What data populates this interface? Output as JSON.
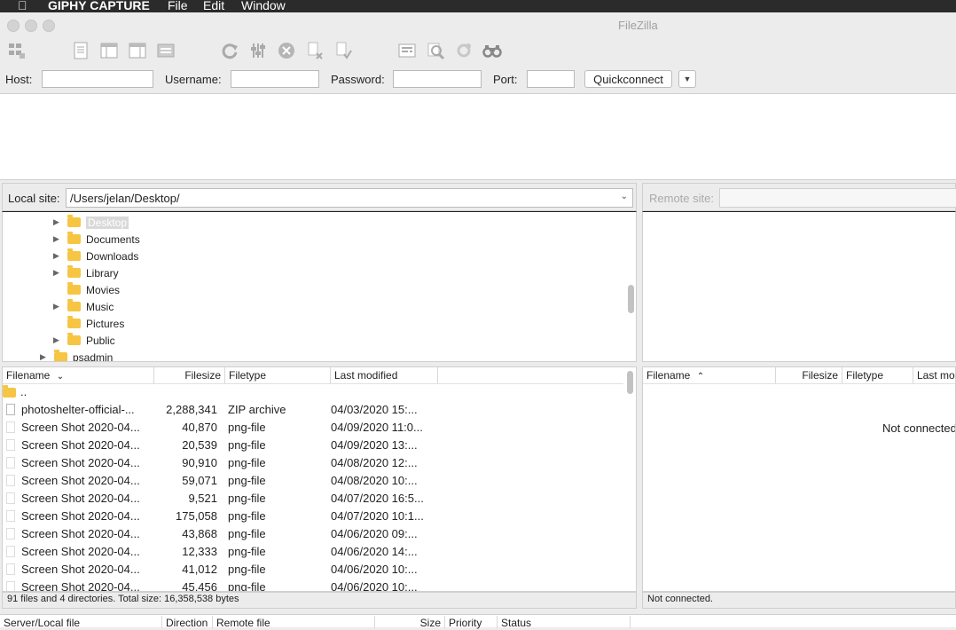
{
  "menubar": {
    "app_name": "GIPHY CAPTURE",
    "items": [
      "File",
      "Edit",
      "Window"
    ]
  },
  "window": {
    "title": "FileZilla"
  },
  "toolbar": {
    "icons": [
      "site-manager-icon",
      "toggle-log-icon",
      "toggle-local-tree-icon",
      "toggle-remote-tree-icon",
      "transfer-queue-icon",
      "refresh-icon",
      "process-queue-icon",
      "cancel-icon",
      "disconnect-icon",
      "reconnect-icon",
      "directory-listing-filter-icon",
      "toggle-compare-icon",
      "sync-browsing-icon",
      "search-icon"
    ]
  },
  "quickconnect": {
    "host_label": "Host:",
    "username_label": "Username:",
    "password_label": "Password:",
    "port_label": "Port:",
    "host_value": "",
    "username_value": "",
    "password_value": "",
    "port_value": "",
    "button_label": "Quickconnect"
  },
  "local_site": {
    "label": "Local site:",
    "path": "/Users/jelan/Desktop/",
    "tree": [
      {
        "name": "Desktop",
        "expandable": true,
        "selected": true
      },
      {
        "name": "Documents",
        "expandable": true
      },
      {
        "name": "Downloads",
        "expandable": true
      },
      {
        "name": "Library",
        "expandable": true
      },
      {
        "name": "Movies",
        "expandable": false
      },
      {
        "name": "Music",
        "expandable": true
      },
      {
        "name": "Pictures",
        "expandable": false
      },
      {
        "name": "Public",
        "expandable": true
      },
      {
        "name": "psadmin",
        "expandable": true
      }
    ]
  },
  "remote_site": {
    "label": "Remote site:",
    "path": ""
  },
  "local_list": {
    "headers": [
      "Filename",
      "Filesize",
      "Filetype",
      "Last modified"
    ],
    "rows": [
      {
        "name": "..",
        "size": "",
        "type": "",
        "modified": ""
      },
      {
        "name": "photoshelter-official-...",
        "size": "2,288,341",
        "type": "ZIP archive",
        "modified": "04/03/2020 15:..."
      },
      {
        "name": "Screen Shot 2020-04...",
        "size": "40,870",
        "type": "png-file",
        "modified": "04/09/2020 11:0..."
      },
      {
        "name": "Screen Shot 2020-04...",
        "size": "20,539",
        "type": "png-file",
        "modified": "04/09/2020 13:..."
      },
      {
        "name": "Screen Shot 2020-04...",
        "size": "90,910",
        "type": "png-file",
        "modified": "04/08/2020 12:..."
      },
      {
        "name": "Screen Shot 2020-04...",
        "size": "59,071",
        "type": "png-file",
        "modified": "04/08/2020 10:..."
      },
      {
        "name": "Screen Shot 2020-04...",
        "size": "9,521",
        "type": "png-file",
        "modified": "04/07/2020 16:5..."
      },
      {
        "name": "Screen Shot 2020-04...",
        "size": "175,058",
        "type": "png-file",
        "modified": "04/07/2020 10:1..."
      },
      {
        "name": "Screen Shot 2020-04...",
        "size": "43,868",
        "type": "png-file",
        "modified": "04/06/2020 09:..."
      },
      {
        "name": "Screen Shot 2020-04...",
        "size": "12,333",
        "type": "png-file",
        "modified": "04/06/2020 14:..."
      },
      {
        "name": "Screen Shot 2020-04...",
        "size": "41,012",
        "type": "png-file",
        "modified": "04/06/2020 10:..."
      },
      {
        "name": "Screen Shot 2020-04...",
        "size": "45,456",
        "type": "png-file",
        "modified": "04/06/2020 10:..."
      }
    ],
    "status": "91 files and 4 directories. Total size: 16,358,538 bytes"
  },
  "remote_list": {
    "headers": [
      "Filename",
      "Filesize",
      "Filetype",
      "Last modified"
    ],
    "empty_message": "Not connected",
    "status": "Not connected."
  },
  "queue": {
    "headers": [
      "Server/Local file",
      "Direction",
      "Remote file",
      "Size",
      "Priority",
      "Status"
    ]
  }
}
